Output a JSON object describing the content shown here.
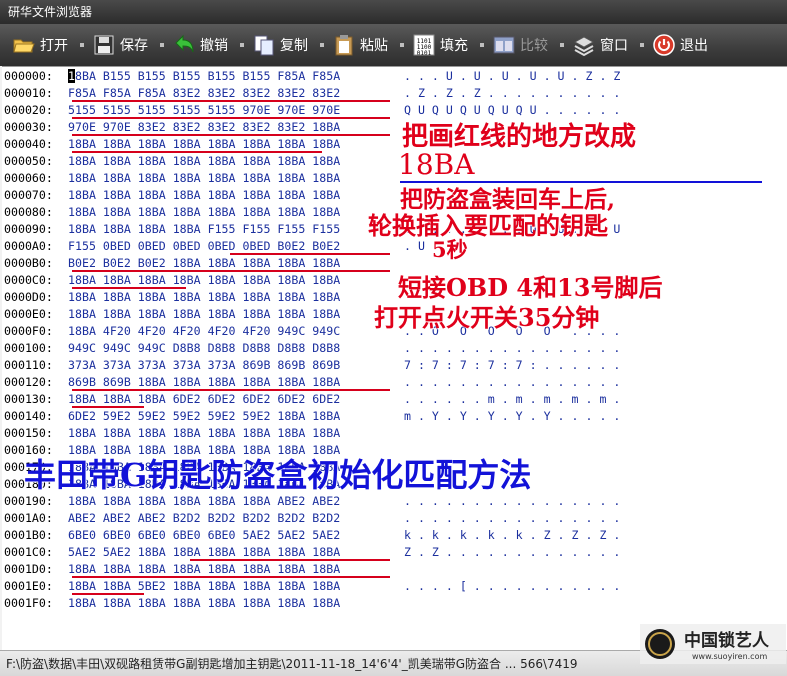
{
  "window": {
    "title": "研华文件浏览器"
  },
  "toolbar": {
    "items": [
      {
        "label": "打开",
        "icon": "open-folder-icon",
        "enabled": true
      },
      {
        "label": "保存",
        "icon": "floppy-save-icon",
        "enabled": true
      },
      {
        "label": "撤销",
        "icon": "undo-arrow-icon",
        "enabled": true
      },
      {
        "label": "复制",
        "icon": "copy-document-icon",
        "enabled": true
      },
      {
        "label": "粘贴",
        "icon": "paste-clipboard-icon",
        "enabled": true
      },
      {
        "label": "填充",
        "icon": "binary-fill-icon",
        "enabled": true
      },
      {
        "label": "比较",
        "icon": "compare-window-icon",
        "enabled": false
      },
      {
        "label": "窗口",
        "icon": "window-stack-icon",
        "enabled": true
      },
      {
        "label": "退出",
        "icon": "power-exit-icon",
        "enabled": true
      }
    ]
  },
  "hex_rows": [
    {
      "addr": "000000:",
      "hex": "18BA B155 B155 B155 B155 B155 F85A F85A",
      "ascii": ". . . U . U . U . U . U . Z . Z"
    },
    {
      "addr": "000010:",
      "hex": "F85A F85A F85A 83E2 83E2 83E2 83E2 83E2",
      "ascii": ". Z . Z . Z . . . . . . . . . ."
    },
    {
      "addr": "000020:",
      "hex": "5155 5155 5155 5155 5155 970E 970E 970E",
      "ascii": "Q U Q U Q U Q U Q U . . . . . ."
    },
    {
      "addr": "000030:",
      "hex": "970E 970E 83E2 83E2 83E2 83E2 83E2 18BA",
      "ascii": ""
    },
    {
      "addr": "000040:",
      "hex": "18BA 18BA 18BA 18BA 18BA 18BA 18BA 18BA",
      "ascii": ""
    },
    {
      "addr": "000050:",
      "hex": "18BA 18BA 18BA 18BA 18BA 18BA 18BA 18BA",
      "ascii": ""
    },
    {
      "addr": "000060:",
      "hex": "18BA 18BA 18BA 18BA 18BA 18BA 18BA 18BA",
      "ascii": ""
    },
    {
      "addr": "000070:",
      "hex": "18BA 18BA 18BA 18BA 18BA 18BA 18BA 18BA",
      "ascii": ""
    },
    {
      "addr": "000080:",
      "hex": "18BA 18BA 18BA 18BA 18BA 18BA 18BA 18BA",
      "ascii": ""
    },
    {
      "addr": "000090:",
      "hex": "18BA 18BA 18BA 18BA F155 F155 F155 F155",
      "ascii": ". . . . . . . . . U . U . U . U"
    },
    {
      "addr": "0000A0:",
      "hex": "F155 0BED 0BED 0BED 0BED 0BED B0E2 B0E2",
      "ascii": ". U"
    },
    {
      "addr": "0000B0:",
      "hex": "B0E2 B0E2 B0E2 18BA 18BA 18BA 18BA 18BA",
      "ascii": ""
    },
    {
      "addr": "0000C0:",
      "hex": "18BA 18BA 18BA 18BA 18BA 18BA 18BA 18BA",
      "ascii": ""
    },
    {
      "addr": "0000D0:",
      "hex": "18BA 18BA 18BA 18BA 18BA 18BA 18BA 18BA",
      "ascii": ""
    },
    {
      "addr": "0000E0:",
      "hex": "18BA 18BA 18BA 18BA 18BA 18BA 18BA 18BA",
      "ascii": ""
    },
    {
      "addr": "0000F0:",
      "hex": "18BA 4F20 4F20 4F20 4F20 4F20 949C 949C",
      "ascii": ". . O   O   O   O   O   . . . ."
    },
    {
      "addr": "000100:",
      "hex": "949C 949C 949C D8B8 D8B8 D8B8 D8B8 D8B8",
      "ascii": ". . . . . . . . . . . . . . . ."
    },
    {
      "addr": "000110:",
      "hex": "373A 373A 373A 373A 373A 869B 869B 869B",
      "ascii": "7 : 7 : 7 : 7 : 7 : . . . . . ."
    },
    {
      "addr": "000120:",
      "hex": "869B 869B 18BA 18BA 18BA 18BA 18BA 18BA",
      "ascii": ". . . . . . . . . . . . . . . ."
    },
    {
      "addr": "000130:",
      "hex": "18BA 18BA 18BA 6DE2 6DE2 6DE2 6DE2 6DE2",
      "ascii": ". . . . . . m . m . m . m . m ."
    },
    {
      "addr": "000140:",
      "hex": "6DE2 59E2 59E2 59E2 59E2 59E2 18BA 18BA",
      "ascii": "m . Y . Y . Y . Y . Y . . . . ."
    },
    {
      "addr": "000150:",
      "hex": "18BA 18BA 18BA 18BA 18BA 18BA 18BA 18BA",
      "ascii": ""
    },
    {
      "addr": "000160:",
      "hex": "18BA 18BA 18BA 18BA 18BA 18BA 18BA 18BA",
      "ascii": ""
    },
    {
      "addr": "000170:",
      "hex": "18BA 18BA 18BA 18BA 18BA 18BA 18BA 18BA",
      "ascii": ""
    },
    {
      "addr": "000180:",
      "hex": "18BA 18BA 18BA 18BA 18BA 18BA 18BA 18BA",
      "ascii": ""
    },
    {
      "addr": "000190:",
      "hex": "18BA 18BA 18BA 18BA 18BA 18BA ABE2 ABE2",
      "ascii": ". . . . . . . . . . . . . . . ."
    },
    {
      "addr": "0001A0:",
      "hex": "ABE2 ABE2 ABE2 B2D2 B2D2 B2D2 B2D2 B2D2",
      "ascii": ". . . . . . . . . . . . . . . ."
    },
    {
      "addr": "0001B0:",
      "hex": "6BE0 6BE0 6BE0 6BE0 6BE0 5AE2 5AE2 5AE2",
      "ascii": "k . k . k . k . k . Z . Z . Z ."
    },
    {
      "addr": "0001C0:",
      "hex": "5AE2 5AE2 18BA 18BA 18BA 18BA 18BA 18BA",
      "ascii": "Z . Z . . . . . . . . . . . . ."
    },
    {
      "addr": "0001D0:",
      "hex": "18BA 18BA 18BA 18BA 18BA 18BA 18BA 18BA",
      "ascii": ""
    },
    {
      "addr": "0001E0:",
      "hex": "18BA 18BA 5BE2 18BA 18BA 18BA 18BA 18BA",
      "ascii": ". . . . [ . . . . . . . . . . ."
    },
    {
      "addr": "0001F0:",
      "hex": "18BA 18BA 18BA 18BA 18BA 18BA 18BA 18BA",
      "ascii": ""
    }
  ],
  "annotations": {
    "note1": "把画红线的地方改成",
    "note1_value": "18BA",
    "note2": "把防盗盒装回车上后,",
    "note3": "轮换插入要匹配的钥匙",
    "note4": "5秒",
    "note5": "短接OBD 4和13号脚后",
    "note6": "打开点火开关35分钟",
    "title": "丰田带G钥匙防盗盒初始化匹配方法"
  },
  "statusbar": {
    "path": "F:\\防盗\\数据\\丰田\\双砚路租赁带G副钥匙增加主钥匙\\2011-11-18_14'6'4'_凯美瑞带G防盗合 ... 566\\7419"
  },
  "watermark": {
    "text": "中国锁艺人",
    "url_text": "www.suoyiren.com"
  },
  "colors": {
    "annotation_red": "#e0001a",
    "annotation_blue": "#1212d8",
    "hex_text": "#1b2f9e",
    "underline": "#d6001c"
  }
}
